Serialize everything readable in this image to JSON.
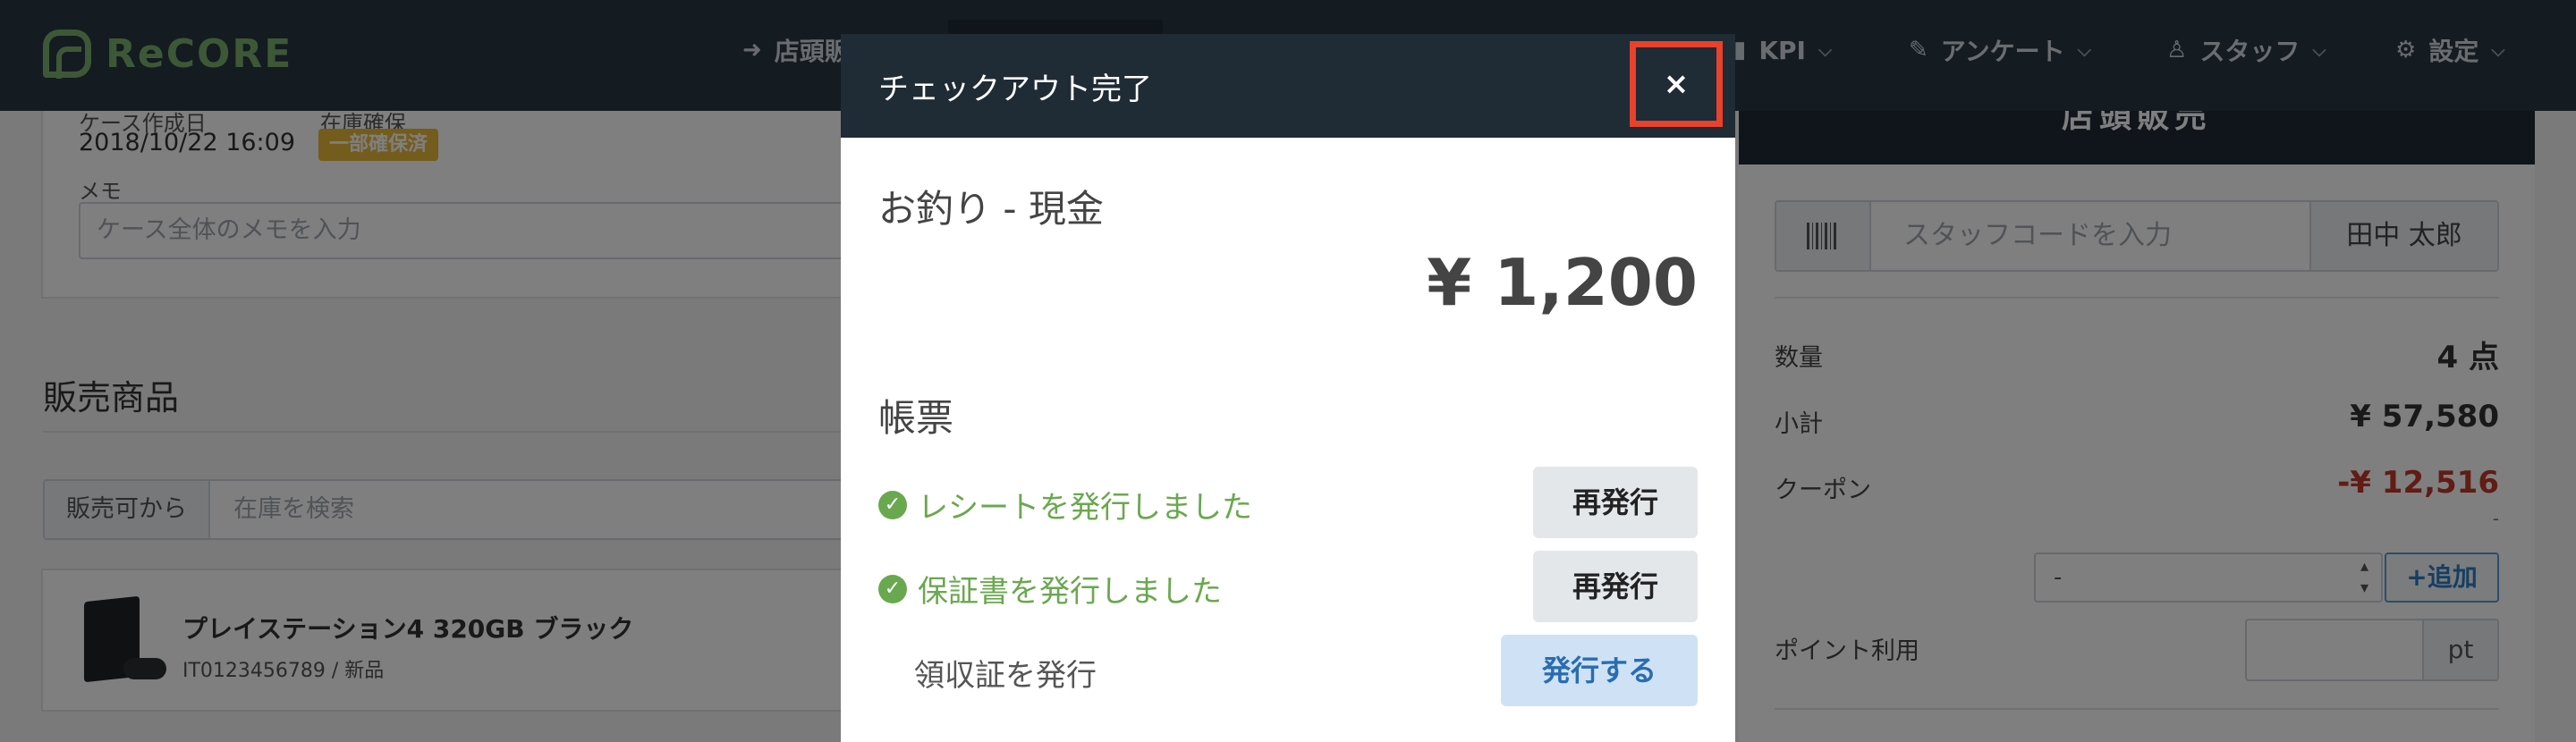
{
  "app": {
    "logo_text": "ReCORE"
  },
  "nav": {
    "items": [
      {
        "label": "店頭販売",
        "icon": "sign-in-icon"
      },
      {
        "label": "KPI",
        "icon": "bar-chart-icon"
      },
      {
        "label": "アンケート",
        "icon": "edit-icon"
      },
      {
        "label": "スタッフ",
        "icon": "user-icon"
      },
      {
        "label": "設定",
        "icon": "gear-icon"
      }
    ]
  },
  "case": {
    "created_label": "ケース作成日",
    "created_value": "2018/10/22 16:09",
    "stock_label": "在庫確保",
    "stock_badge": "一部確保済",
    "memo_label": "メモ",
    "memo_placeholder": "ケース全体のメモを入力"
  },
  "products": {
    "title": "販売商品",
    "filter_label": "販売可から",
    "search_placeholder": "在庫を検索",
    "items": [
      {
        "name": "プレイステーション4 320GB ブラック",
        "sub": "IT0123456789 / 新品"
      }
    ]
  },
  "register": {
    "header": "店頭販売",
    "staff_placeholder": "スタッフコードを入力",
    "staff_name": "田中 太郎",
    "quantity_label": "数量",
    "quantity_value": "4 点",
    "subtotal_label": "小計",
    "subtotal_value": "¥ 57,580",
    "coupon_label": "クーポン",
    "coupon_value": "-¥ 12,516",
    "coupon_dash": "-",
    "coupon_select_value": "-",
    "add_label": "追加",
    "points_label": "ポイント利用",
    "points_unit": "pt"
  },
  "modal": {
    "title": "チェックアウト完了",
    "close_symbol": "×",
    "change_label": "お釣り - 現金",
    "change_amount": "¥ 1,200",
    "documents_title": "帳票",
    "documents": [
      {
        "status": "レシートを発行しました",
        "button": "再発行",
        "issued": true
      },
      {
        "status": "保証書を発行しました",
        "button": "再発行",
        "issued": true
      },
      {
        "status": "領収証を発行",
        "button": "発行する",
        "issued": false
      }
    ]
  },
  "colors": {
    "nav_bg": "#283642",
    "brand_green": "#7ab06c",
    "success_green": "#6aa84f",
    "danger_red": "#c0392b",
    "highlight_red": "#e8412c",
    "primary_blue": "#2a6cb0"
  }
}
